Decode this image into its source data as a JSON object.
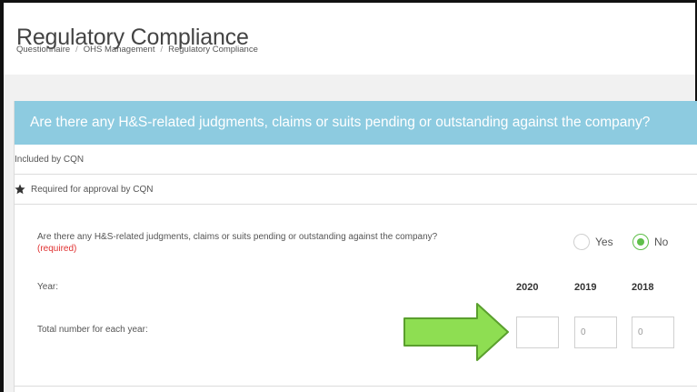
{
  "page": {
    "title": "Regulatory Compliance",
    "breadcrumb": [
      "Questionnaire",
      "OHS Management",
      "Regulatory Compliance"
    ]
  },
  "panel": {
    "header": "Are there any H&S-related judgments, claims or suits pending or outstanding against the company?",
    "included_by": "Included by CQN",
    "required_for_approval": "Required for approval by CQN"
  },
  "question": {
    "text": "Are there any H&S-related judgments, claims or suits pending or outstanding against the company?",
    "required_note": "(required)",
    "options": [
      {
        "label": "Yes",
        "selected": false
      },
      {
        "label": "No",
        "selected": true
      }
    ]
  },
  "years": {
    "label": "Year:",
    "columns": [
      "2020",
      "2019",
      "2018"
    ]
  },
  "totals": {
    "label": "Total number for each year:",
    "values": [
      "",
      "0",
      "0"
    ]
  },
  "colors": {
    "header_bg": "#8dcbe0",
    "selected_radio": "#5fbf4a",
    "required": "#e03030",
    "arrow": "#8ede52"
  },
  "icons": {
    "required_star": "star-icon",
    "highlight_arrow": "right-arrow-icon"
  }
}
